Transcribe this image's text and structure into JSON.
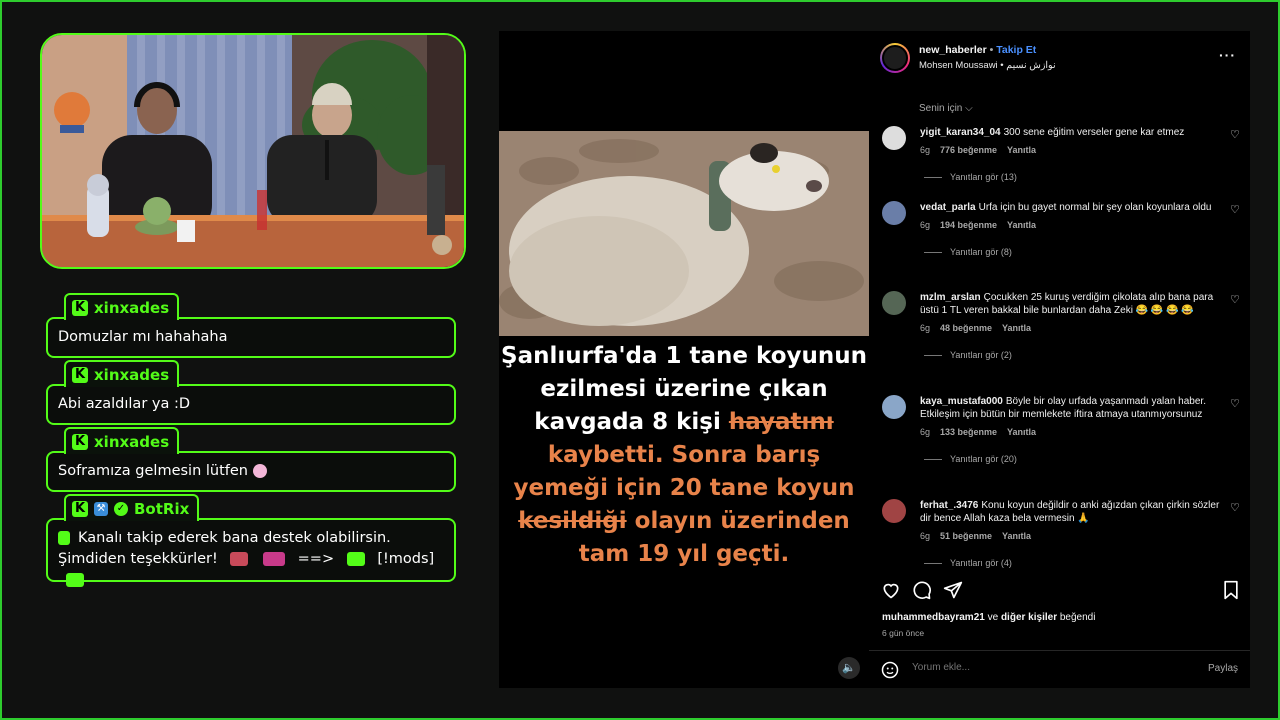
{
  "chat": [
    {
      "username": "xinxades",
      "message": "Domuzlar mı hahahaha"
    },
    {
      "username": "xinxades",
      "message": "Abi azaldılar ya :D"
    },
    {
      "username": "xinxades",
      "message": "Soframıza gelmesin lütfen"
    },
    {
      "username": "BotRix",
      "message": "Kanalı takip ederek bana destek olabilirsin. Şimdiden teşekkürler!",
      "suffix_arrow": "==>",
      "suffix_mods": "[!mods]"
    }
  ],
  "post": {
    "caption_white": "Şanlıurfa'da 1 tane koyunun ezilmesi üzerine çıkan kavgada 8 kişi",
    "caption_strike1": "hayatını",
    "caption_orange1": "kaybetti. Sonra barış yemeği için 20 tane koyun",
    "caption_strike2": "kesildiği",
    "caption_orange2": "olayın üzerinden tam 19 yıl geçti."
  },
  "panel": {
    "username": "new_haberler",
    "follow": "Takip Et",
    "subtitle": "Mohsen Moussawi • نوازش نسیم",
    "senin_icin": "Senin için ⌵",
    "comments": [
      {
        "user": "yigit_karan34_04",
        "text": "300 sene eğitim verseler gene kar etmez",
        "age": "6g",
        "likes": "776 beğenme",
        "reply": "Yanıtla",
        "replies": "Yanıtları gör (13)",
        "avatar_color": "#ddd"
      },
      {
        "user": "vedat_parla",
        "text": "Urfa için bu gayet normal bir şey olan koyunlara oldu",
        "age": "6g",
        "likes": "194 beğenme",
        "reply": "Yanıtla",
        "replies": "Yanıtları gör (8)",
        "avatar_color": "#6a7ea8"
      },
      {
        "user": "mzlm_arslan",
        "text": "Çocukken 25 kuruş verdiğim çikolata alıp bana para üstü 1 TL veren bakkal bile bunlardan daha Zeki 😂 😂 😂 😂",
        "age": "6g",
        "likes": "48 beğenme",
        "reply": "Yanıtla",
        "replies": "Yanıtları gör (2)",
        "avatar_color": "#556655"
      },
      {
        "user": "kaya_mustafa000",
        "text": "Böyle bir olay urfada yaşanmadı yalan haber. Etkileşim için bütün bir memlekete iftira atmaya utanmıyorsunuz",
        "age": "6g",
        "likes": "133 beğenme",
        "reply": "Yanıtla",
        "replies": "Yanıtları gör (20)",
        "avatar_color": "#8aa6c8"
      },
      {
        "user": "ferhat_.3476",
        "text": "Konu koyun değildir o anki ağızdan çıkan çirkin sözler dir bence Allah kaza bela vermesin 🙏",
        "age": "6g",
        "likes": "51 beğenme",
        "reply": "Yanıtla",
        "replies": "Yanıtları gör (4)",
        "avatar_color": "#a04444"
      }
    ],
    "liked_by_user": "muhammedbayram21",
    "liked_by_rest": "ve",
    "liked_by_others": "diğer kişiler",
    "liked_by_end": "beğendi",
    "time": "6 gün önce",
    "comment_placeholder": "Yorum ekle...",
    "share": "Paylaş"
  }
}
